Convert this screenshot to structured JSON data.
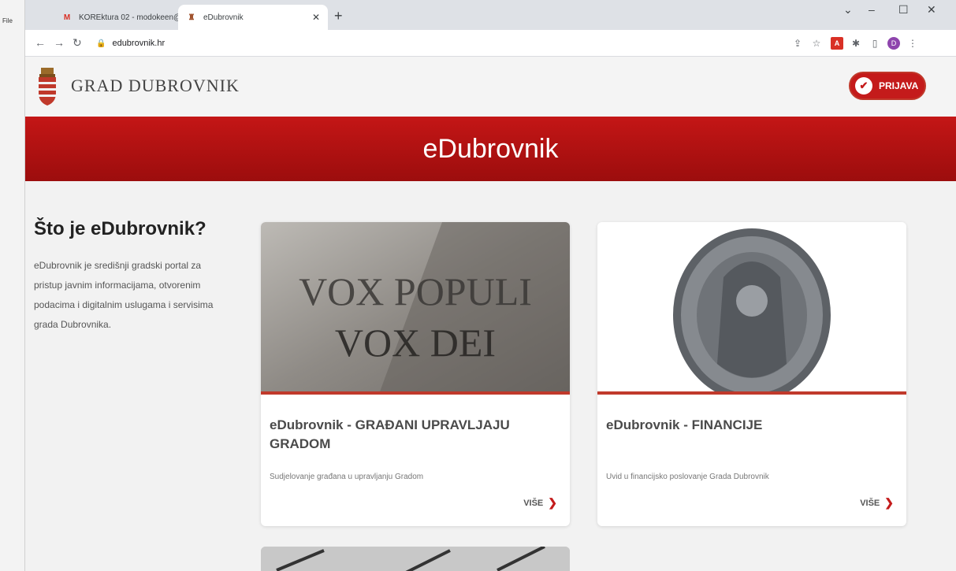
{
  "browser": {
    "tabs": [
      {
        "title": "KOREktura 02 - modokeen@gm...",
        "favicon": "gmail-icon"
      },
      {
        "title": "eDubrovnik",
        "favicon": "dubrovnik-crest-icon"
      }
    ],
    "url": "edubrovnik.hr",
    "file_label": "File",
    "profile_initial": "D"
  },
  "header": {
    "site_name": "GRAD DUBROVNIK",
    "login_label": "PRIJAVA"
  },
  "banner": {
    "title": "eDubrovnik"
  },
  "intro": {
    "heading": "Što je eDubrovnik?",
    "text": "eDubrovnik je središnji gradski portal za pristup javnim informacijama, otvorenim podacima i digitalnim uslugama i servisima grada Dubrovnika."
  },
  "cards": [
    {
      "image_text_line1": "VOX POPULI",
      "image_text_line2": "VOX DEI",
      "title": "eDubrovnik - GRAĐANI UPRAVLJAJU GRADOM",
      "description": "Sudjelovanje građana u upravljanju Gradom",
      "more_label": "VIŠE"
    },
    {
      "title": "eDubrovnik - FINANCIJE",
      "description": "Uvid u financijsko poslovanje Grada Dubrovnik",
      "more_label": "VIŠE"
    }
  ],
  "colors": {
    "brand_red": "#c41b1b",
    "banner_red": "#b01010"
  }
}
